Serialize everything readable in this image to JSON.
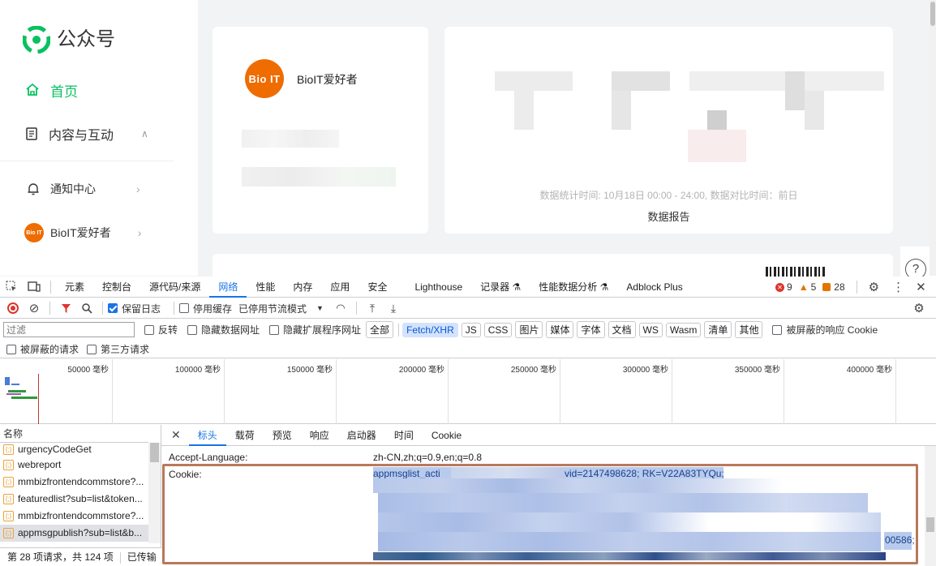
{
  "app": {
    "brand": "公众号",
    "nav": {
      "home": "首页",
      "content": "内容与互动",
      "notice": "通知中心",
      "account": "BioIT爱好者"
    },
    "account_card": {
      "avatar_text": "Bio IT",
      "name": "BioIT爱好者"
    },
    "stats": {
      "time_note": "数据统计时间: 10月18日 00:00 - 24:00, 数据对比时间：前日",
      "report": "数据报告"
    },
    "help": "?",
    "colors": {
      "accent": "#07c160",
      "avatar": "#ef6c00"
    }
  },
  "devtools": {
    "tabs": [
      "元素",
      "控制台",
      "源代码/来源",
      "网络",
      "性能",
      "内存",
      "应用",
      "安全",
      "Lighthouse",
      "记录器",
      "性能数据分析",
      "Adblock Plus"
    ],
    "active_tab": "网络",
    "errors": "9",
    "warnings": "5",
    "issues": "28",
    "toolbar": {
      "preserve_log": "保留日志",
      "disable_cache": "停用缓存",
      "throttle": "已停用节流模式"
    },
    "filter": {
      "placeholder": "过滤",
      "invert": "反转",
      "hide_data_urls": "隐藏数据网址",
      "hide_ext_urls": "隐藏扩展程序网址",
      "types": [
        "全部",
        "Fetch/XHR",
        "JS",
        "CSS",
        "图片",
        "媒体",
        "字体",
        "文档",
        "WS",
        "Wasm",
        "清单",
        "其他"
      ],
      "active_type": "Fetch/XHR",
      "blocked_cookies": "被屏蔽的响应 Cookie",
      "blocked_requests": "被屏蔽的请求",
      "third_party": "第三方请求"
    },
    "overview_ticks": [
      "50000 毫秒",
      "100000 毫秒",
      "150000 毫秒",
      "200000 毫秒",
      "250000 毫秒",
      "300000 毫秒",
      "350000 毫秒",
      "400000 毫秒"
    ],
    "list": {
      "header": "名称",
      "rows": [
        "urgencyCodeGet",
        "webreport",
        "mmbizfrontendcommstore?...",
        "featuredlist?sub=list&token...",
        "mmbizfrontendcommstore?...",
        "appmsgpublish?sub=list&b..."
      ],
      "selected_index": 5,
      "status": "第 28 项请求，共 124 项",
      "status2": "已传输"
    },
    "detail": {
      "tabs": [
        "标头",
        "载荷",
        "预览",
        "响应",
        "启动器",
        "时间",
        "Cookie"
      ],
      "active_tab": "标头",
      "accept_language_name": "Accept-Language:",
      "accept_language_value": "zh-CN,zh;q=0.9,en;q=0.8",
      "cookie_name": "Cookie:",
      "cookie_start": "appmsglist_acti",
      "cookie_mid": "vid=2147498628; RK=V22A83TYQu;",
      "cookie_end": "00586;"
    }
  }
}
